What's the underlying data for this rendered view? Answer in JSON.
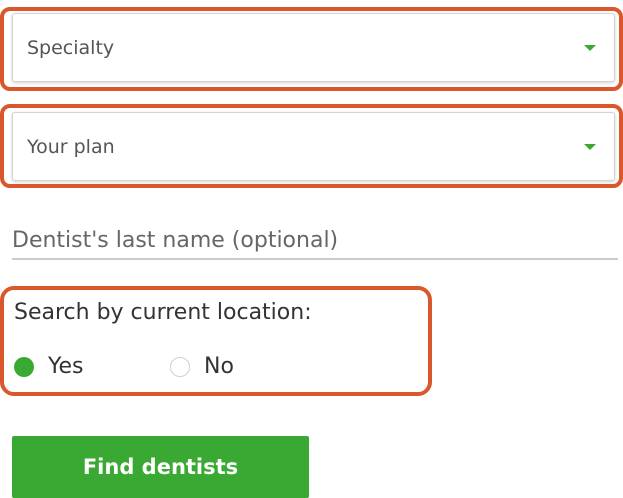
{
  "specialty": {
    "placeholder": "Specialty",
    "icon": "chevron-down-icon"
  },
  "plan": {
    "placeholder": "Your plan",
    "icon": "chevron-down-icon"
  },
  "lastname": {
    "placeholder": "Dentist's last name (optional)",
    "value": ""
  },
  "location": {
    "label": "Search by current location:",
    "options": [
      {
        "label": "Yes",
        "selected": true
      },
      {
        "label": "No",
        "selected": false
      }
    ]
  },
  "find_button": {
    "label": "Find dentists"
  },
  "colors": {
    "accent_green": "#3aa933",
    "highlight_orange": "#d9582b"
  }
}
